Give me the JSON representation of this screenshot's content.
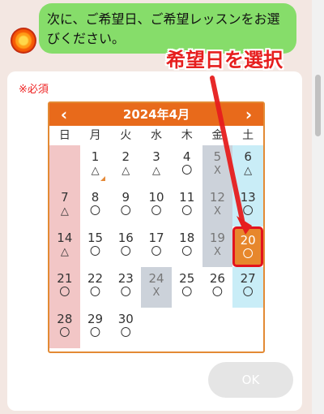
{
  "chat": {
    "message": "次に、ご希望日、ご希望レッスンをお選びください。"
  },
  "form": {
    "required_label": "※必須",
    "ok_label": "OK"
  },
  "annotation": {
    "text": "希望日を選択"
  },
  "calendar": {
    "month_label": "2024年4月",
    "prev_icon": "chevron-left-icon",
    "next_icon": "chevron-right-icon",
    "weekdays": [
      "日",
      "月",
      "火",
      "水",
      "木",
      "金",
      "土"
    ],
    "selected_day": "20",
    "days": [
      {
        "day": "",
        "mark": "",
        "status": "empty",
        "col": 0
      },
      {
        "day": "1",
        "mark": "△",
        "status": "few",
        "col": 1,
        "corner": true
      },
      {
        "day": "2",
        "mark": "△",
        "status": "few",
        "col": 2
      },
      {
        "day": "3",
        "mark": "△",
        "status": "few",
        "col": 3
      },
      {
        "day": "4",
        "mark": "〇",
        "status": "open",
        "col": 4
      },
      {
        "day": "5",
        "mark": "X",
        "status": "closed",
        "col": 5
      },
      {
        "day": "6",
        "mark": "△",
        "status": "few",
        "col": 6
      },
      {
        "day": "7",
        "mark": "△",
        "status": "few",
        "col": 0
      },
      {
        "day": "8",
        "mark": "〇",
        "status": "open",
        "col": 1
      },
      {
        "day": "9",
        "mark": "〇",
        "status": "open",
        "col": 2
      },
      {
        "day": "10",
        "mark": "〇",
        "status": "open",
        "col": 3
      },
      {
        "day": "11",
        "mark": "〇",
        "status": "open",
        "col": 4
      },
      {
        "day": "12",
        "mark": "X",
        "status": "closed",
        "col": 5
      },
      {
        "day": "13",
        "mark": "〇",
        "status": "open",
        "col": 6
      },
      {
        "day": "14",
        "mark": "△",
        "status": "few",
        "col": 0
      },
      {
        "day": "15",
        "mark": "〇",
        "status": "open",
        "col": 1
      },
      {
        "day": "16",
        "mark": "〇",
        "status": "open",
        "col": 2
      },
      {
        "day": "17",
        "mark": "〇",
        "status": "open",
        "col": 3
      },
      {
        "day": "18",
        "mark": "〇",
        "status": "open",
        "col": 4
      },
      {
        "day": "19",
        "mark": "X",
        "status": "closed",
        "col": 5
      },
      {
        "day": "20",
        "mark": "〇",
        "status": "open",
        "col": 6
      },
      {
        "day": "21",
        "mark": "〇",
        "status": "open",
        "col": 0
      },
      {
        "day": "22",
        "mark": "〇",
        "status": "open",
        "col": 1
      },
      {
        "day": "23",
        "mark": "〇",
        "status": "open",
        "col": 2
      },
      {
        "day": "24",
        "mark": "X",
        "status": "closed",
        "col": 3
      },
      {
        "day": "25",
        "mark": "〇",
        "status": "open",
        "col": 4
      },
      {
        "day": "26",
        "mark": "〇",
        "status": "open",
        "col": 5
      },
      {
        "day": "27",
        "mark": "〇",
        "status": "open",
        "col": 6
      },
      {
        "day": "28",
        "mark": "〇",
        "status": "open",
        "col": 0
      },
      {
        "day": "29",
        "mark": "〇",
        "status": "open",
        "col": 1
      },
      {
        "day": "30",
        "mark": "〇",
        "status": "open",
        "col": 2
      }
    ]
  },
  "colors": {
    "header": "#e86a1b",
    "bubble": "#86dd6a",
    "sunday": "#f2c6c6",
    "saturday": "#c9edf7",
    "closed": "#ccd2da",
    "annotation": "#e61e1e"
  }
}
